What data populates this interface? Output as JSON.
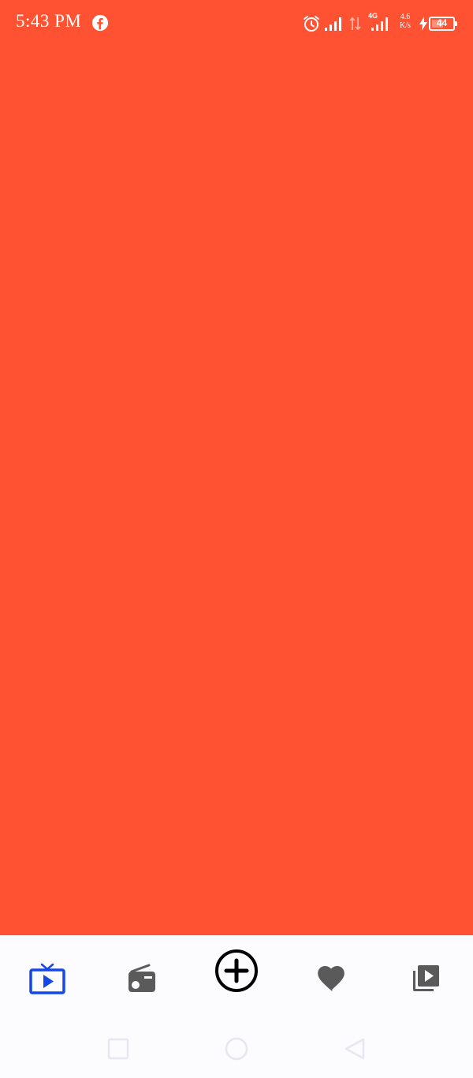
{
  "status_bar": {
    "time": "5:43 PM",
    "network_type": "4G",
    "speed_value": "4.6",
    "speed_unit": "K/s",
    "battery": "44",
    "icons": [
      "facebook-icon",
      "alarm-icon",
      "signal-icon",
      "data-arrows-icon",
      "signal-icon",
      "charging-icon",
      "battery-icon"
    ]
  },
  "theme": {
    "background": "#ff5232",
    "nav_background": "#fcfbfe",
    "active_icon": "#1447e6",
    "inactive_icon": "#5a5a5a",
    "center_icon": "#000000"
  },
  "bottom_nav": {
    "items": [
      {
        "icon": "live-tv-icon",
        "active": true
      },
      {
        "icon": "radio-icon",
        "active": false
      },
      {
        "icon": "add-circle-icon",
        "active": false
      },
      {
        "icon": "heart-icon",
        "active": false
      },
      {
        "icon": "video-library-icon",
        "active": false
      }
    ]
  },
  "system_nav": {
    "buttons": [
      "recents-button",
      "home-button",
      "back-button"
    ]
  }
}
